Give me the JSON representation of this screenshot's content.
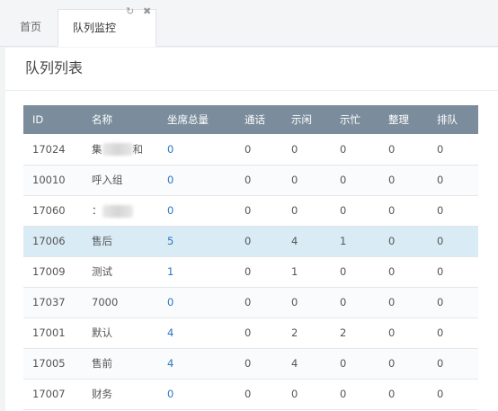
{
  "tabs": [
    {
      "label": "首页"
    },
    {
      "label": "队列监控"
    }
  ],
  "tab_icons": {
    "refresh": "↻",
    "close": "✖"
  },
  "panel": {
    "title": "队列列表"
  },
  "table": {
    "headers": [
      "ID",
      "名称",
      "坐席总量",
      "通话",
      "示闲",
      "示忙",
      "整理",
      "排队"
    ],
    "rows": [
      {
        "id": "17024",
        "name_prefix": "集",
        "name_suffix": "和",
        "redacted": true,
        "total": "0",
        "calls": "0",
        "idle": "0",
        "busy": "0",
        "wrap": "0",
        "queue": "0"
      },
      {
        "id": "10010",
        "name": "呼入组",
        "total": "0",
        "calls": "0",
        "idle": "0",
        "busy": "0",
        "wrap": "0",
        "queue": "0"
      },
      {
        "id": "17060",
        "name_prefix": "：",
        "name_suffix": "",
        "redacted": true,
        "total": "0",
        "calls": "0",
        "idle": "0",
        "busy": "0",
        "wrap": "0",
        "queue": "0"
      },
      {
        "id": "17006",
        "name": "售后",
        "total": "5",
        "calls": "0",
        "idle": "4",
        "busy": "1",
        "wrap": "0",
        "queue": "0",
        "selected": true
      },
      {
        "id": "17009",
        "name": "测试",
        "total": "1",
        "calls": "0",
        "idle": "1",
        "busy": "0",
        "wrap": "0",
        "queue": "0"
      },
      {
        "id": "17037",
        "name": "7000",
        "total": "0",
        "calls": "0",
        "idle": "0",
        "busy": "0",
        "wrap": "0",
        "queue": "0"
      },
      {
        "id": "17001",
        "name": "默认",
        "total": "4",
        "calls": "0",
        "idle": "2",
        "busy": "2",
        "wrap": "0",
        "queue": "0"
      },
      {
        "id": "17005",
        "name": "售前",
        "total": "4",
        "calls": "0",
        "idle": "4",
        "busy": "0",
        "wrap": "0",
        "queue": "0"
      },
      {
        "id": "17007",
        "name": "财务",
        "total": "0",
        "calls": "0",
        "idle": "0",
        "busy": "0",
        "wrap": "0",
        "queue": "0"
      }
    ]
  },
  "colors": {
    "header_bg": "#7b8d9c",
    "selected_row": "#d9ebf5",
    "link": "#2d76bf"
  }
}
